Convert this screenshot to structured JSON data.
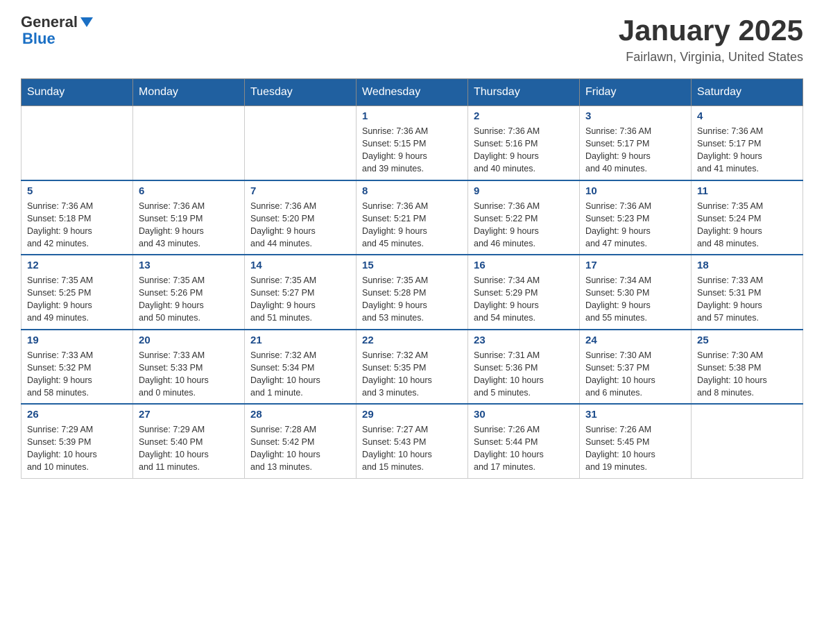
{
  "header": {
    "logo": {
      "general": "General",
      "blue": "Blue"
    },
    "title": "January 2025",
    "location": "Fairlawn, Virginia, United States"
  },
  "calendar": {
    "days_of_week": [
      "Sunday",
      "Monday",
      "Tuesday",
      "Wednesday",
      "Thursday",
      "Friday",
      "Saturday"
    ],
    "weeks": [
      [
        {
          "day": "",
          "info": ""
        },
        {
          "day": "",
          "info": ""
        },
        {
          "day": "",
          "info": ""
        },
        {
          "day": "1",
          "info": "Sunrise: 7:36 AM\nSunset: 5:15 PM\nDaylight: 9 hours\nand 39 minutes."
        },
        {
          "day": "2",
          "info": "Sunrise: 7:36 AM\nSunset: 5:16 PM\nDaylight: 9 hours\nand 40 minutes."
        },
        {
          "day": "3",
          "info": "Sunrise: 7:36 AM\nSunset: 5:17 PM\nDaylight: 9 hours\nand 40 minutes."
        },
        {
          "day": "4",
          "info": "Sunrise: 7:36 AM\nSunset: 5:17 PM\nDaylight: 9 hours\nand 41 minutes."
        }
      ],
      [
        {
          "day": "5",
          "info": "Sunrise: 7:36 AM\nSunset: 5:18 PM\nDaylight: 9 hours\nand 42 minutes."
        },
        {
          "day": "6",
          "info": "Sunrise: 7:36 AM\nSunset: 5:19 PM\nDaylight: 9 hours\nand 43 minutes."
        },
        {
          "day": "7",
          "info": "Sunrise: 7:36 AM\nSunset: 5:20 PM\nDaylight: 9 hours\nand 44 minutes."
        },
        {
          "day": "8",
          "info": "Sunrise: 7:36 AM\nSunset: 5:21 PM\nDaylight: 9 hours\nand 45 minutes."
        },
        {
          "day": "9",
          "info": "Sunrise: 7:36 AM\nSunset: 5:22 PM\nDaylight: 9 hours\nand 46 minutes."
        },
        {
          "day": "10",
          "info": "Sunrise: 7:36 AM\nSunset: 5:23 PM\nDaylight: 9 hours\nand 47 minutes."
        },
        {
          "day": "11",
          "info": "Sunrise: 7:35 AM\nSunset: 5:24 PM\nDaylight: 9 hours\nand 48 minutes."
        }
      ],
      [
        {
          "day": "12",
          "info": "Sunrise: 7:35 AM\nSunset: 5:25 PM\nDaylight: 9 hours\nand 49 minutes."
        },
        {
          "day": "13",
          "info": "Sunrise: 7:35 AM\nSunset: 5:26 PM\nDaylight: 9 hours\nand 50 minutes."
        },
        {
          "day": "14",
          "info": "Sunrise: 7:35 AM\nSunset: 5:27 PM\nDaylight: 9 hours\nand 51 minutes."
        },
        {
          "day": "15",
          "info": "Sunrise: 7:35 AM\nSunset: 5:28 PM\nDaylight: 9 hours\nand 53 minutes."
        },
        {
          "day": "16",
          "info": "Sunrise: 7:34 AM\nSunset: 5:29 PM\nDaylight: 9 hours\nand 54 minutes."
        },
        {
          "day": "17",
          "info": "Sunrise: 7:34 AM\nSunset: 5:30 PM\nDaylight: 9 hours\nand 55 minutes."
        },
        {
          "day": "18",
          "info": "Sunrise: 7:33 AM\nSunset: 5:31 PM\nDaylight: 9 hours\nand 57 minutes."
        }
      ],
      [
        {
          "day": "19",
          "info": "Sunrise: 7:33 AM\nSunset: 5:32 PM\nDaylight: 9 hours\nand 58 minutes."
        },
        {
          "day": "20",
          "info": "Sunrise: 7:33 AM\nSunset: 5:33 PM\nDaylight: 10 hours\nand 0 minutes."
        },
        {
          "day": "21",
          "info": "Sunrise: 7:32 AM\nSunset: 5:34 PM\nDaylight: 10 hours\nand 1 minute."
        },
        {
          "day": "22",
          "info": "Sunrise: 7:32 AM\nSunset: 5:35 PM\nDaylight: 10 hours\nand 3 minutes."
        },
        {
          "day": "23",
          "info": "Sunrise: 7:31 AM\nSunset: 5:36 PM\nDaylight: 10 hours\nand 5 minutes."
        },
        {
          "day": "24",
          "info": "Sunrise: 7:30 AM\nSunset: 5:37 PM\nDaylight: 10 hours\nand 6 minutes."
        },
        {
          "day": "25",
          "info": "Sunrise: 7:30 AM\nSunset: 5:38 PM\nDaylight: 10 hours\nand 8 minutes."
        }
      ],
      [
        {
          "day": "26",
          "info": "Sunrise: 7:29 AM\nSunset: 5:39 PM\nDaylight: 10 hours\nand 10 minutes."
        },
        {
          "day": "27",
          "info": "Sunrise: 7:29 AM\nSunset: 5:40 PM\nDaylight: 10 hours\nand 11 minutes."
        },
        {
          "day": "28",
          "info": "Sunrise: 7:28 AM\nSunset: 5:42 PM\nDaylight: 10 hours\nand 13 minutes."
        },
        {
          "day": "29",
          "info": "Sunrise: 7:27 AM\nSunset: 5:43 PM\nDaylight: 10 hours\nand 15 minutes."
        },
        {
          "day": "30",
          "info": "Sunrise: 7:26 AM\nSunset: 5:44 PM\nDaylight: 10 hours\nand 17 minutes."
        },
        {
          "day": "31",
          "info": "Sunrise: 7:26 AM\nSunset: 5:45 PM\nDaylight: 10 hours\nand 19 minutes."
        },
        {
          "day": "",
          "info": ""
        }
      ]
    ]
  }
}
